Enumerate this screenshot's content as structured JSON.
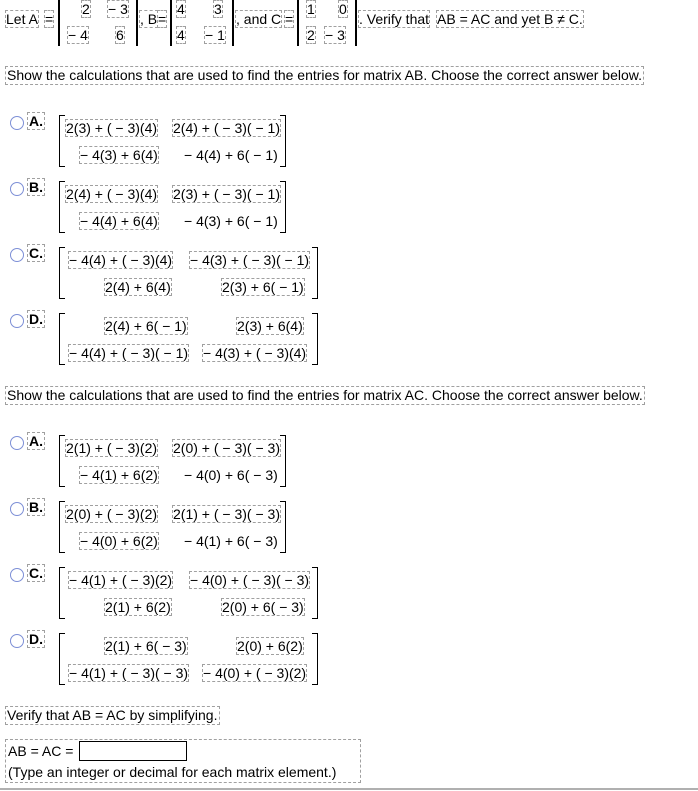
{
  "header": {
    "let_a": "Let A",
    "equals": "=",
    "matrix_a": [
      [
        "2",
        "− 3"
      ],
      [
        "− 4",
        "6"
      ]
    ],
    "comma_b": ", B",
    "matrix_b": [
      [
        "4",
        "3"
      ],
      [
        "4",
        "− 1"
      ]
    ],
    "and_c": ", and C",
    "matrix_c": [
      [
        "1",
        "0"
      ],
      [
        "2",
        "− 3"
      ]
    ],
    "verify_prefix": ". Verify that",
    "verify_statement": "AB = AC and yet B ≠ C."
  },
  "part1": {
    "prompt": "Show the calculations that are used to find the entries for matrix AB. Choose the correct answer below.",
    "options": [
      {
        "letter": "A.",
        "rows": [
          [
            "2(3) + ( − 3)(4)",
            "2(4) + ( − 3)( − 1)"
          ],
          [
            "− 4(3) + 6(4)",
            "− 4(4) + 6( − 1)"
          ]
        ]
      },
      {
        "letter": "B.",
        "rows": [
          [
            "2(4) + ( − 3)(4)",
            "2(3) + ( − 3)( − 1)"
          ],
          [
            "− 4(4) + 6(4)",
            "− 4(3) + 6( − 1)"
          ]
        ]
      },
      {
        "letter": "C.",
        "rows": [
          [
            "− 4(4) + ( − 3)(4)",
            "− 4(3) + ( − 3)( − 1)"
          ],
          [
            "2(4) + 6(4)",
            "2(3) + 6( − 1)"
          ]
        ]
      },
      {
        "letter": "D.",
        "rows": [
          [
            "2(4) + 6( − 1)",
            "2(3) + 6(4)"
          ],
          [
            "− 4(4) + ( − 3)( − 1)",
            "− 4(3) + ( − 3)(4)"
          ]
        ]
      }
    ]
  },
  "part2": {
    "prompt": "Show the calculations that are used to find the entries for matrix AC. Choose the correct answer below.",
    "options": [
      {
        "letter": "A.",
        "rows": [
          [
            "2(1) + ( − 3)(2)",
            "2(0) + ( − 3)( − 3)"
          ],
          [
            "− 4(1) + 6(2)",
            "− 4(0) + 6( − 3)"
          ]
        ]
      },
      {
        "letter": "B.",
        "rows": [
          [
            "2(0) + ( − 3)(2)",
            "2(1) + ( − 3)( − 3)"
          ],
          [
            "− 4(0) + 6(2)",
            "− 4(1) + 6( − 3)"
          ]
        ]
      },
      {
        "letter": "C.",
        "rows": [
          [
            "− 4(1) + ( − 3)(2)",
            "− 4(0) + ( − 3)( − 3)"
          ],
          [
            "2(1) + 6(2)",
            "2(0) + 6( − 3)"
          ]
        ]
      },
      {
        "letter": "D.",
        "rows": [
          [
            "2(1) + 6( − 3)",
            "2(0) + 6(2)"
          ],
          [
            "− 4(1) + ( − 3)( − 3)",
            "− 4(0) + ( − 3)(2)"
          ]
        ]
      }
    ]
  },
  "part3": {
    "prompt": "Verify that AB = AC by simplifying.",
    "answer_label": "AB = AC =",
    "answer_value": "",
    "hint": "(Type an integer or decimal for each matrix element.)"
  }
}
